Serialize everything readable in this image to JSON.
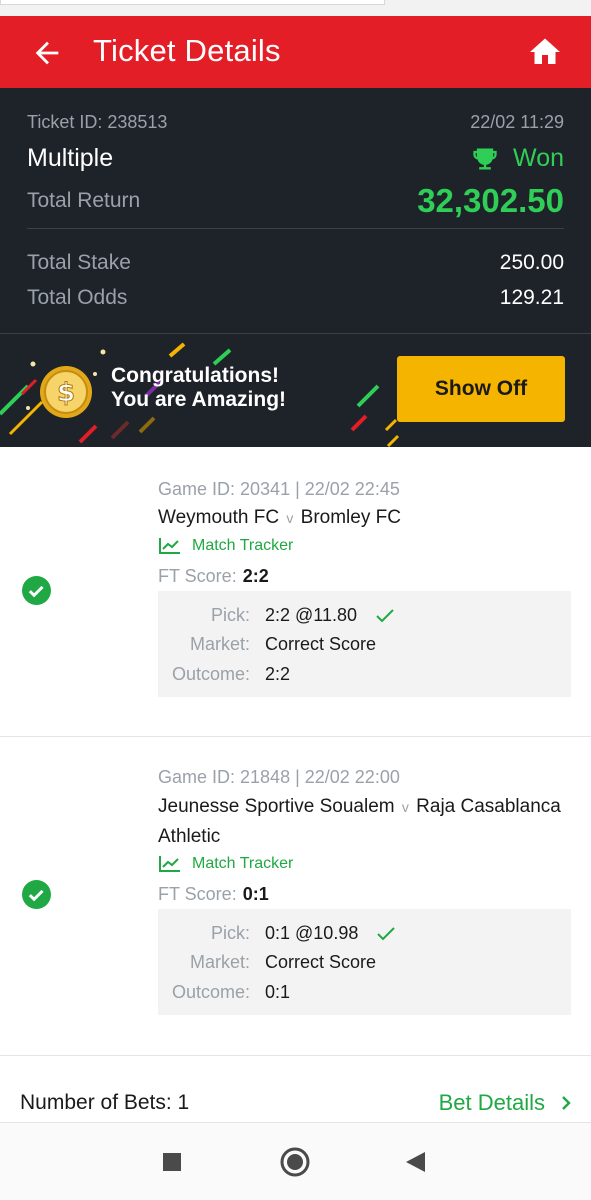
{
  "header": {
    "title": "Ticket Details",
    "back_icon": "arrow-left-icon",
    "home_icon": "home-icon",
    "color": "#e41e26"
  },
  "summary": {
    "ticket_id": "Ticket ID: 238513",
    "datetime": "22/02 11:29",
    "bet_type": "Multiple",
    "status": "Won",
    "status_icon": "trophy-icon",
    "total_return_label": "Total Return",
    "total_return": "32,302.50",
    "total_stake_label": "Total Stake",
    "total_stake": "250.00",
    "total_odds_label": "Total Odds",
    "total_odds": "129.21",
    "won_color": "#2fcf57"
  },
  "banner": {
    "line1": "Congratulations!",
    "line2": "You are Amazing!",
    "button": "Show Off",
    "coin_icon": "coin-icon",
    "button_color": "#f5b400"
  },
  "games": [
    {
      "meta": "Game ID: 20341 | 22/02 22:45",
      "home": "Weymouth FC",
      "vs": "v",
      "away": "Bromley FC",
      "tracker": "Match Tracker",
      "ft_label": "FT Score:",
      "ft_score": "2:2",
      "pick_label": "Pick:",
      "pick": "2:2 @11.80",
      "market_label": "Market:",
      "market": "Correct Score",
      "outcome_label": "Outcome:",
      "outcome": "2:2"
    },
    {
      "meta": "Game ID: 21848 | 22/02 22:00",
      "home": "Jeunesse Sportive Soualem",
      "vs": "v",
      "away": "Raja Casablanca Athletic",
      "tracker": "Match Tracker",
      "ft_label": "FT Score:",
      "ft_score": "0:1",
      "pick_label": "Pick:",
      "pick": "0:1 @10.98",
      "market_label": "Market:",
      "market": "Correct Score",
      "outcome_label": "Outcome:",
      "outcome": "0:1"
    }
  ],
  "footer": {
    "number_of_bets": "Number of Bets: 1",
    "bet_details": "Bet Details"
  },
  "accent_green": "#1fa843"
}
